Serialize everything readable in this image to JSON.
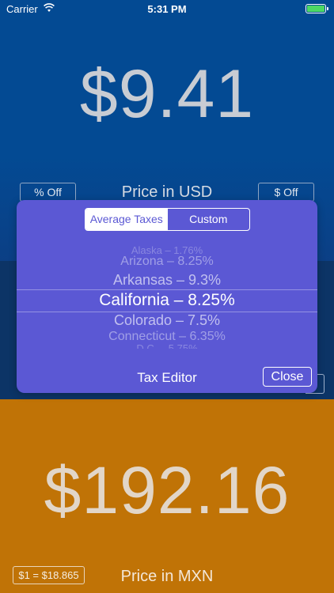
{
  "status_bar": {
    "carrier": "Carrier",
    "time": "5:31 PM",
    "battery_color": "#4cd964"
  },
  "usd_panel": {
    "price": "$9.41",
    "label": "Price in USD",
    "percent_off_label": "% Off",
    "dollar_off_label": "$ Off",
    "background": "#034a93"
  },
  "tax_editor": {
    "segments": [
      {
        "label": "Average Taxes",
        "selected": true
      },
      {
        "label": "Custom",
        "selected": false
      }
    ],
    "picker_items": [
      "Alaska – 1.76%",
      "Arizona – 8.25%",
      "Arkansas – 9.3%",
      "California – 8.25%",
      "Colorado – 7.5%",
      "Connecticut – 6.35%",
      "D.C. – 5.75%"
    ],
    "selected_item": "California – 8.25%",
    "title": "Tax Editor",
    "close_label": "Close",
    "background": "#5b58d4"
  },
  "mxn_panel": {
    "price": "$192.16",
    "label": "Price in MXN",
    "rate_label": "$1 = $18.865",
    "background": "#c07306"
  }
}
